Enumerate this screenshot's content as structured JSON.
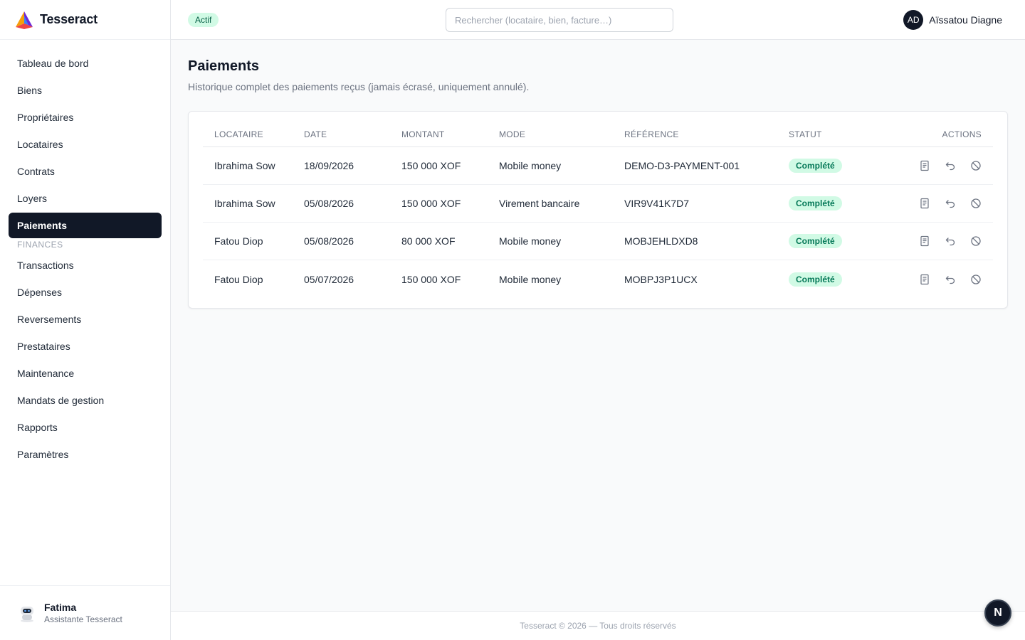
{
  "brand": {
    "name": "Tesseract",
    "logo_icon": "tesseract-logo-icon"
  },
  "sidebar": {
    "items": [
      {
        "label": "Tableau de bord"
      },
      {
        "label": "Biens"
      },
      {
        "label": "Propriétaires"
      },
      {
        "label": "Locataires"
      },
      {
        "label": "Contrats"
      },
      {
        "label": "Loyers"
      },
      {
        "label": "Paiements",
        "active": true
      }
    ],
    "section_label": "FINANCES",
    "items2": [
      {
        "label": "Transactions"
      },
      {
        "label": "Dépenses"
      },
      {
        "label": "Reversements"
      },
      {
        "label": "Prestataires"
      },
      {
        "label": "Maintenance"
      },
      {
        "label": "Mandats de gestion"
      },
      {
        "label": "Rapports"
      },
      {
        "label": "Paramètres"
      }
    ],
    "assistant": {
      "name": "Fatima",
      "role": "Assistante Tesseract"
    }
  },
  "header": {
    "status_badge": "Actif",
    "search_placeholder": "Rechercher (locataire, bien, facture…)",
    "user_initials": "AD",
    "user_name": "Aïssatou Diagne"
  },
  "page": {
    "title": "Paiements",
    "subtitle": "Historique complet des paiements reçus (jamais écrasé, uniquement annulé)."
  },
  "table": {
    "columns": [
      "LOCATAIRE",
      "DATE",
      "MONTANT",
      "MODE",
      "RÉFÉRENCE",
      "STATUT",
      "ACTIONS"
    ],
    "rows": [
      {
        "locataire": "Ibrahima Sow",
        "date": "18/09/2026",
        "montant": "150 000 XOF",
        "mode": "Mobile money",
        "reference": "DEMO-D3-PAYMENT-001",
        "statut": "Complété"
      },
      {
        "locataire": "Ibrahima Sow",
        "date": "05/08/2026",
        "montant": "150 000 XOF",
        "mode": "Virement bancaire",
        "reference": "VIR9V41K7D7",
        "statut": "Complété"
      },
      {
        "locataire": "Fatou Diop",
        "date": "05/08/2026",
        "montant": "80 000 XOF",
        "mode": "Mobile money",
        "reference": "MOBJEHLDXD8",
        "statut": "Complété"
      },
      {
        "locataire": "Fatou Diop",
        "date": "05/07/2026",
        "montant": "150 000 XOF",
        "mode": "Mobile money",
        "reference": "MOBPJ3P1UCX",
        "statut": "Complété"
      }
    ],
    "action_icons": [
      "receipt-icon",
      "undo-icon",
      "cancel-icon"
    ]
  },
  "footer": {
    "text": "Tesseract © 2026 — Tous droits réservés"
  },
  "fab": {
    "label": "N"
  },
  "colors": {
    "accent_dark": "#111827",
    "success_bg": "#d1fae5",
    "success_text": "#047857"
  }
}
